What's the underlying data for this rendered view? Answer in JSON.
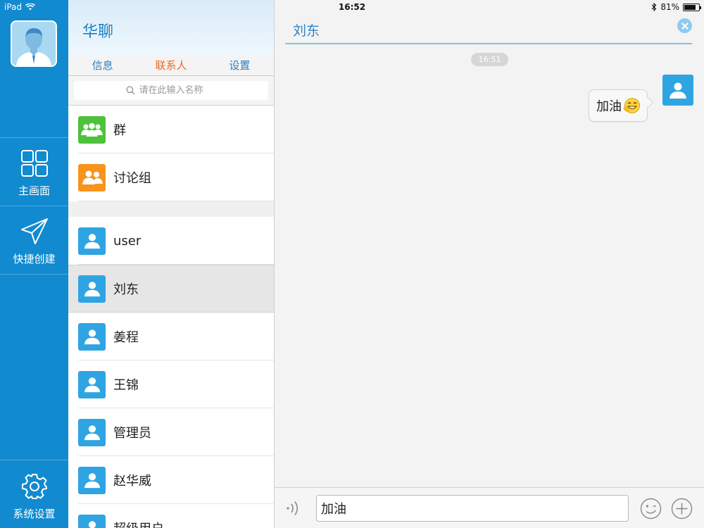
{
  "status_bar": {
    "device": "iPad",
    "time": "16:52",
    "battery": "81%",
    "battery_level": 0.81
  },
  "rail": {
    "items": [
      {
        "label": "主画面",
        "icon": "grid-icon"
      },
      {
        "label": "快捷创建",
        "icon": "paper-plane-icon"
      }
    ],
    "settings_label": "系统设置"
  },
  "panel": {
    "title": "华聊",
    "tabs": [
      "信息",
      "联系人",
      "设置"
    ],
    "active_tab": "联系人",
    "search": {
      "placeholder": "请在此输入名称"
    },
    "groups": [
      {
        "name": "群",
        "color": "#4dc23a"
      },
      {
        "name": "讨论组",
        "color": "#f7941d"
      }
    ],
    "contacts": [
      {
        "name": "user"
      },
      {
        "name": "刘东",
        "selected": true
      },
      {
        "name": "姜程"
      },
      {
        "name": "王锦"
      },
      {
        "name": "管理员"
      },
      {
        "name": "赵华威"
      },
      {
        "name": "超级用户"
      }
    ]
  },
  "chat": {
    "title": "刘东",
    "messages": [
      {
        "time": "16:51",
        "text": "加油",
        "emoji": "grin-emoji",
        "from_self": true
      }
    ],
    "input_value": "加油"
  },
  "colors": {
    "rail": "#118ad0",
    "accent": "#2f84c4",
    "active_tab": "#f06a25",
    "avatar_blue": "#2fa4e2"
  }
}
